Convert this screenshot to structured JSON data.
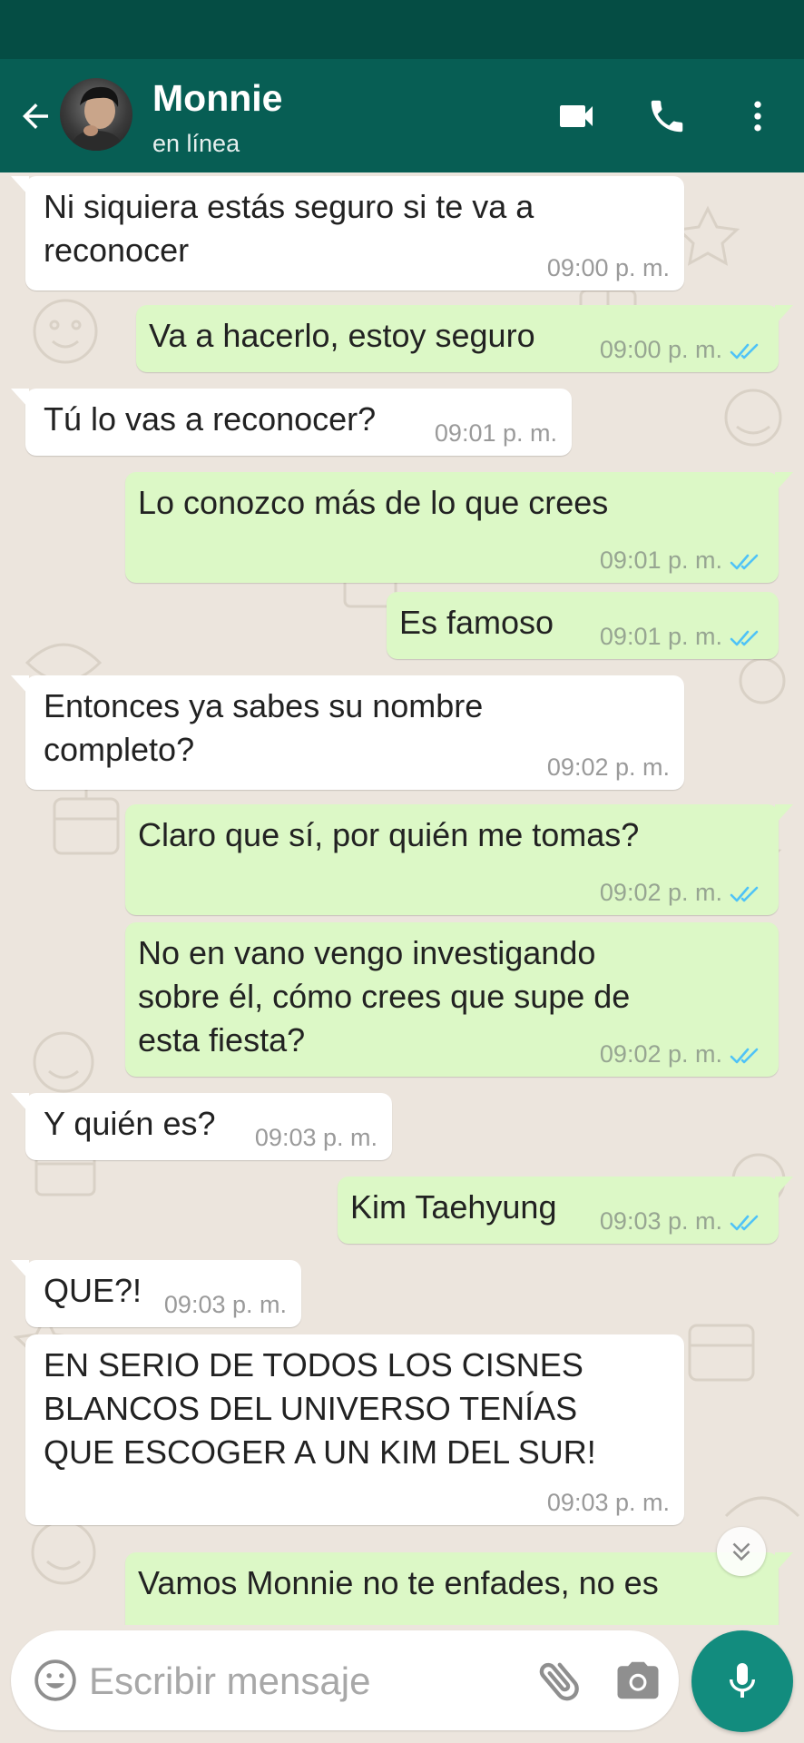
{
  "header": {
    "contact_name": "Monnie",
    "contact_status": "en línea"
  },
  "messages": [
    {
      "dir": "in",
      "lines": [
        "Ni siquiera estás seguro si te va a",
        "reconocer"
      ],
      "time": "09:00 p. m."
    },
    {
      "dir": "out",
      "lines": [
        "Va a hacerlo, estoy seguro"
      ],
      "time": "09:00 p. m.",
      "status": "read"
    },
    {
      "dir": "in",
      "lines": [
        "Tú lo vas a reconocer?"
      ],
      "time": "09:01 p. m."
    },
    {
      "dir": "out",
      "lines": [
        "Lo conozco más de lo que crees"
      ],
      "time": "09:01 p. m.",
      "status": "read"
    },
    {
      "dir": "out",
      "lines": [
        "Es famoso"
      ],
      "time": "09:01 p. m.",
      "status": "read"
    },
    {
      "dir": "in",
      "lines": [
        "Entonces ya sabes su nombre",
        "completo?"
      ],
      "time": "09:02 p. m."
    },
    {
      "dir": "out",
      "lines": [
        "Claro que sí, por quién me tomas?"
      ],
      "time": "09:02 p. m.",
      "status": "read"
    },
    {
      "dir": "out",
      "lines": [
        "No en vano vengo investigando",
        "sobre él, cómo crees que supe de",
        "esta fiesta?"
      ],
      "time": "09:02 p. m.",
      "status": "read"
    },
    {
      "dir": "in",
      "lines": [
        "Y quién es?"
      ],
      "time": "09:03 p. m."
    },
    {
      "dir": "out",
      "lines": [
        "Kim Taehyung"
      ],
      "time": "09:03 p. m.",
      "status": "read"
    },
    {
      "dir": "in",
      "lines": [
        "QUE?!"
      ],
      "time": "09:03 p. m."
    },
    {
      "dir": "in",
      "lines": [
        "EN SERIO DE TODOS LOS CISNES",
        "BLANCOS DEL UNIVERSO TENÍAS",
        "QUE ESCOGER A UN KIM DEL SUR!"
      ],
      "time": "09:03 p. m."
    },
    {
      "dir": "out",
      "lines": [
        "Vamos Monnie no te enfades, no es"
      ],
      "time": "",
      "status": "partial"
    }
  ],
  "composer": {
    "placeholder": "Escribir mensaje"
  },
  "colors": {
    "status_bar": "#054d44",
    "app_bar": "#075e54",
    "chat_background": "#ece5dd",
    "incoming_bubble": "#ffffff",
    "outgoing_bubble": "#dcf8c6",
    "read_ticks": "#4fc3f7",
    "mic_button": "#128c7e"
  },
  "icons": {
    "back": "arrow-left-icon",
    "video_call": "video-camera-icon",
    "voice_call": "phone-icon",
    "menu": "more-vertical-icon",
    "scroll_down": "double-chevron-down-icon",
    "emoji": "smiley-icon",
    "attach": "paperclip-icon",
    "camera": "camera-icon",
    "mic": "microphone-icon"
  }
}
